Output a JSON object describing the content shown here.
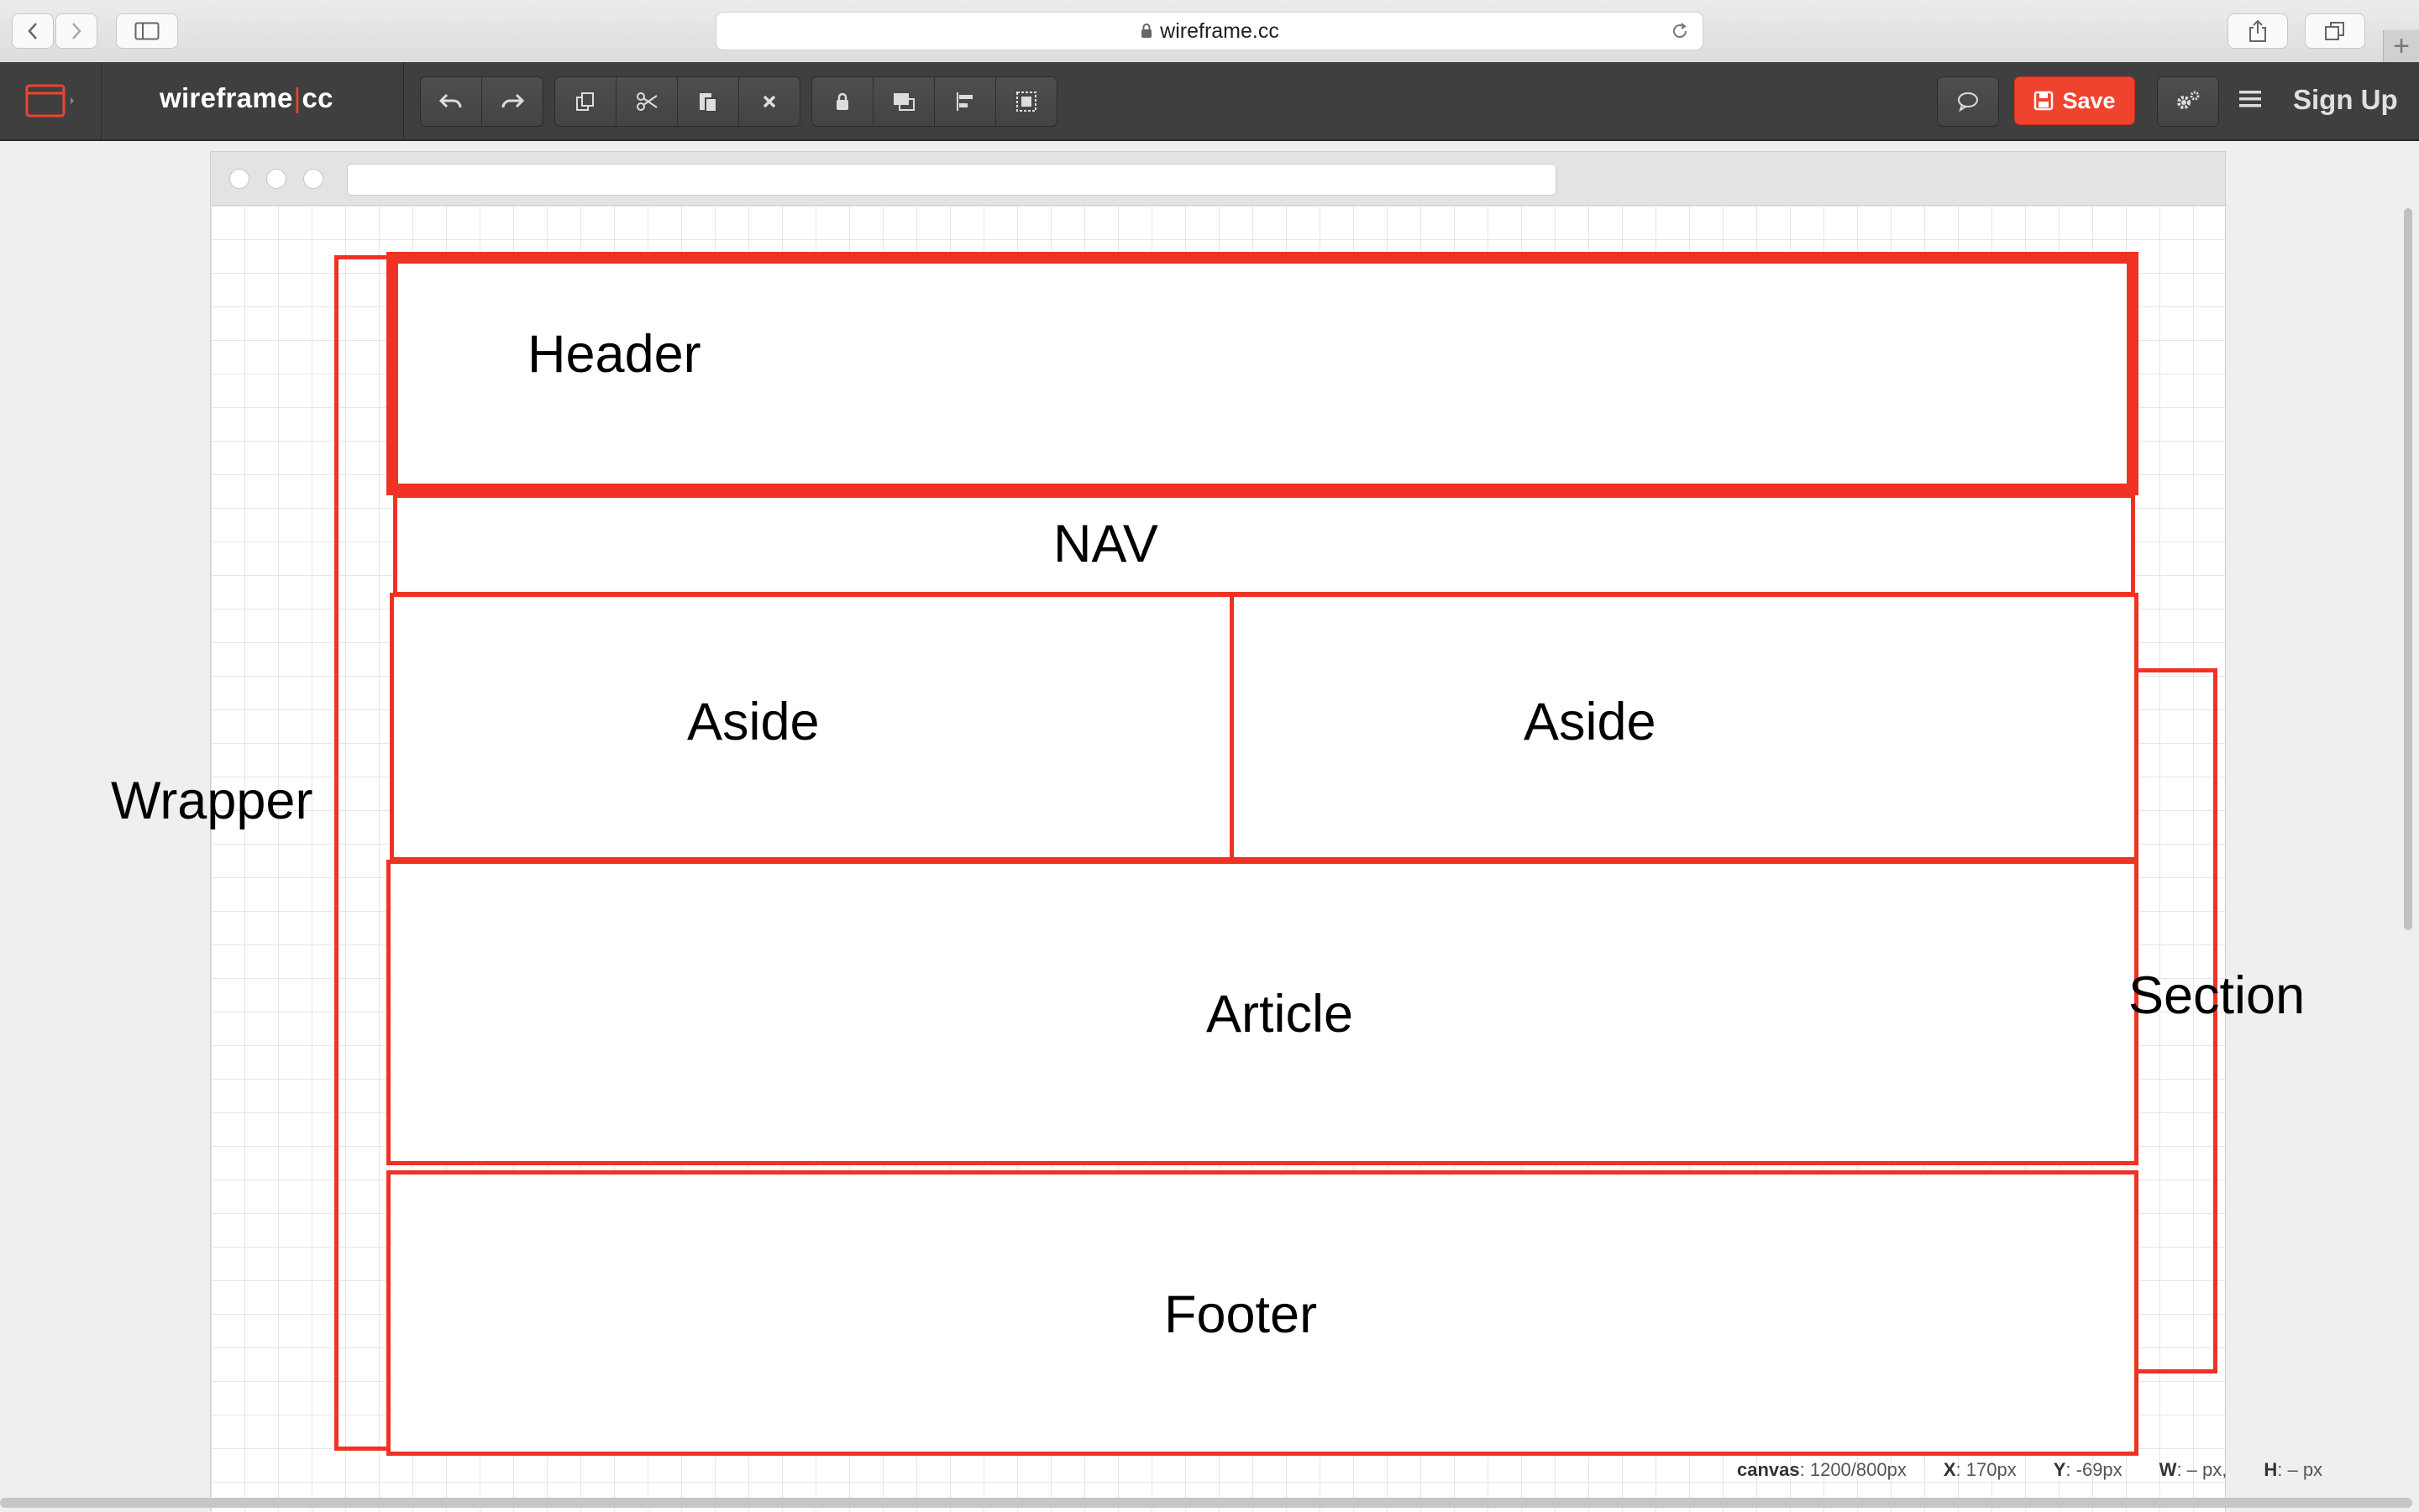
{
  "browser": {
    "url": "wireframe.cc"
  },
  "app": {
    "brand_left": "wireframe",
    "brand_sep": "|",
    "brand_right": "cc",
    "save_label": "Save",
    "signup_label": "Sign Up",
    "accent_color": "#f0432e",
    "toolbar_icons": [
      "undo-icon",
      "redo-icon",
      "copy-icon",
      "cut-icon",
      "paste-icon",
      "delete-icon",
      "lock-icon",
      "bring-front-icon",
      "align-icon",
      "group-icon",
      "comment-icon",
      "settings-icon",
      "menu-icon"
    ]
  },
  "wireframe": {
    "header": "Header",
    "nav": "NAV",
    "aside_left": "Aside",
    "aside_right": "Aside",
    "article": "Article",
    "footer": "Footer",
    "wrapper": "Wrapper",
    "section": "Section",
    "stroke_color": "#f03224"
  },
  "status": {
    "canvas_label": "canvas",
    "canvas_value": ": 1200/800px",
    "x_label": "X",
    "x_value": ": 170px",
    "y_label": "Y",
    "y_value": ": -69px",
    "w_label": "W",
    "w_value": ": – px,",
    "h_label": "H",
    "h_value": ": – px"
  }
}
